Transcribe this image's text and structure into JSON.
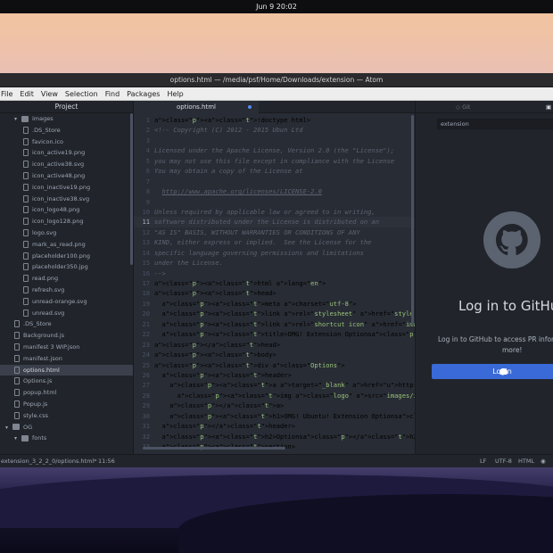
{
  "top_bar": {
    "datetime": "Jun 9  20:02"
  },
  "window": {
    "title": "options.html — /media/psf/Home/Downloads/extension — Atom",
    "menu": [
      "File",
      "Edit",
      "View",
      "Selection",
      "Find",
      "Packages",
      "Help"
    ]
  },
  "sidebar": {
    "title": "Project",
    "items": [
      {
        "label": "images",
        "kind": "folder",
        "depth": 1,
        "open": true
      },
      {
        "label": ".DS_Store",
        "kind": "file",
        "depth": 2
      },
      {
        "label": "favicon.ico",
        "kind": "file",
        "depth": 2
      },
      {
        "label": "icon_active19.png",
        "kind": "file",
        "depth": 2
      },
      {
        "label": "icon_active38.svg",
        "kind": "file",
        "depth": 2
      },
      {
        "label": "icon_active48.png",
        "kind": "file",
        "depth": 2
      },
      {
        "label": "icon_inactive19.png",
        "kind": "file",
        "depth": 2
      },
      {
        "label": "icon_inactive38.svg",
        "kind": "file",
        "depth": 2
      },
      {
        "label": "icon_logo48.png",
        "kind": "file",
        "depth": 2
      },
      {
        "label": "icon_logo128.png",
        "kind": "file",
        "depth": 2
      },
      {
        "label": "logo.svg",
        "kind": "file",
        "depth": 2
      },
      {
        "label": "mark_as_read.png",
        "kind": "file",
        "depth": 2
      },
      {
        "label": "placeholder100.png",
        "kind": "file",
        "depth": 2
      },
      {
        "label": "placeholder350.jpg",
        "kind": "file",
        "depth": 2
      },
      {
        "label": "read.png",
        "kind": "file",
        "depth": 2
      },
      {
        "label": "refresh.svg",
        "kind": "file",
        "depth": 2
      },
      {
        "label": "unread-orange.svg",
        "kind": "file",
        "depth": 2
      },
      {
        "label": "unread.svg",
        "kind": "file",
        "depth": 2
      },
      {
        "label": ".DS_Store",
        "kind": "file",
        "depth": 1
      },
      {
        "label": "Background.js",
        "kind": "file",
        "depth": 1
      },
      {
        "label": "manifest 3 WIP.json",
        "kind": "file",
        "depth": 1
      },
      {
        "label": "manifest.json",
        "kind": "file",
        "depth": 1
      },
      {
        "label": "options.html",
        "kind": "file",
        "depth": 1,
        "selected": true
      },
      {
        "label": "Options.js",
        "kind": "file",
        "depth": 1
      },
      {
        "label": "popup.html",
        "kind": "file",
        "depth": 1
      },
      {
        "label": "Popup.js",
        "kind": "file",
        "depth": 1
      },
      {
        "label": "style.css",
        "kind": "file",
        "depth": 1
      },
      {
        "label": "OG",
        "kind": "folder",
        "depth": 0,
        "open": true
      },
      {
        "label": "fonts",
        "kind": "folder",
        "depth": 1,
        "open": true
      }
    ]
  },
  "editor": {
    "tab": "options.html",
    "current_line": 11,
    "lines": [
      "<!doctype html>",
      "<!-- Copyright (C) 2012 - 2015 Ubun Ltd",
      "",
      "Licensed under the Apache License, Version 2.0 (the \"License\");",
      "you may not use this file except in compliance with the License",
      "You may obtain a copy of the License at",
      "",
      "  http://www.apache.org/licenses/LICENSE-2.0",
      "",
      "Unless required by applicable law or agreed to in writing,",
      "software distributed under the License is distributed on an",
      "\"AS IS\" BASIS, WITHOUT WARRANTIES OR CONDITIONS OF ANY",
      "KIND, either express or implied.  See the License for the",
      "specific language governing permissions and limitations",
      "under the License.",
      "-->",
      "<html lang=\"en\">",
      "<head>",
      "  <meta charset=\"utf-8\">",
      "  <link rel=\"stylesheet\" href=\"style.css\">",
      "  <link rel=\"shortcut icon\" href=\"images/favicon.ico\">",
      "  <title>OMG! Extension Options</title>",
      "</head>",
      "<body>",
      "<div class=\"Options\">",
      "  <header>",
      "    <a target=\"_blank\" href=\"http://www.omgubuntu.co.uk\" class=",
      "      <img class=\"logo\" src=\"images/icon_logo128.png\" height=\"4",
      "    </a>",
      "    <h1>OMG! Ubuntu! Extension Options</h1>",
      "  </header>",
      "  <h2>Options</h2>",
      "  <section>"
    ]
  },
  "git_pane": {
    "tab_git": "Git",
    "tab_github": "GitHub",
    "search": "extension",
    "heading": "Log in to GitHub",
    "description_l1": "Log in to GitHub to access PR inform",
    "description_l2": "more!",
    "login_button": "Login"
  },
  "status_bar": {
    "path": "extension_3_2_2_0/options.html*",
    "cursor": "11:56",
    "line_ending": "LF",
    "encoding": "UTF-8",
    "grammar": "HTML"
  }
}
